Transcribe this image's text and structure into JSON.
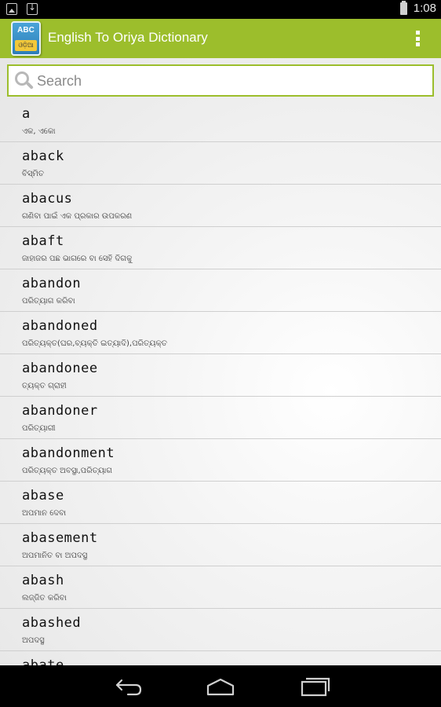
{
  "status_bar": {
    "time": "1:08",
    "left_icons": [
      "image-notification-icon",
      "download-notification-icon"
    ],
    "right_icons": [
      "battery-icon"
    ]
  },
  "action_bar": {
    "logo_top": "ABC",
    "logo_bottom": "ଓଡ଼ିଆ",
    "title": "English To Oriya Dictionary",
    "color": "#9cbe2c",
    "menu_icon": "overflow-menu-icon"
  },
  "search": {
    "placeholder": "Search",
    "value": "",
    "icon": "search-icon"
  },
  "words": [
    {
      "en": "a",
      "or": "ଏକ, ଏକୋ"
    },
    {
      "en": "aback",
      "or": "ବିସ୍ମିତ"
    },
    {
      "en": "abacus",
      "or": "ଗଣିବା ପାଇଁ ଏକ ପ୍ରକାର ଉପକରଣ"
    },
    {
      "en": "abaft",
      "or": "ଜାହାଜର ପଛ ଭାଗରେ ବା ସେହି ଦିଗକୁ"
    },
    {
      "en": "abandon",
      "or": "ପରିତ୍ୟାଗ କରିବା"
    },
    {
      "en": "abandoned",
      "or": "ପରିତ୍ୟକ୍ତ(ଘର,ବ୍ୟକ୍ତି ଇତ୍ୟାଦି),ପରିତ୍ୟକ୍ତ"
    },
    {
      "en": "abandonee",
      "or": "ତ୍ୟକ୍ତ ଗ୍ରାହୀ"
    },
    {
      "en": "abandoner",
      "or": "ପରିତ୍ୟାଗୀ"
    },
    {
      "en": "abandonment",
      "or": "ପରିତ୍ୟକ୍ତ ଅବସ୍ଥା,ପରିତ୍ୟାଗ"
    },
    {
      "en": "abase",
      "or": "ଅପମାନ ଦେବା"
    },
    {
      "en": "abasement",
      "or": "ଅପମାନିତ ବା ଅପଦସ୍ଥ"
    },
    {
      "en": "abash",
      "or": "ଲଜ୍ଜିତ କରିବା"
    },
    {
      "en": "abashed",
      "or": "ଅପଦସ୍ଥ"
    },
    {
      "en": "abate",
      "or": ""
    }
  ],
  "nav_bar": {
    "buttons": [
      "back-icon",
      "home-icon",
      "recents-icon"
    ]
  }
}
